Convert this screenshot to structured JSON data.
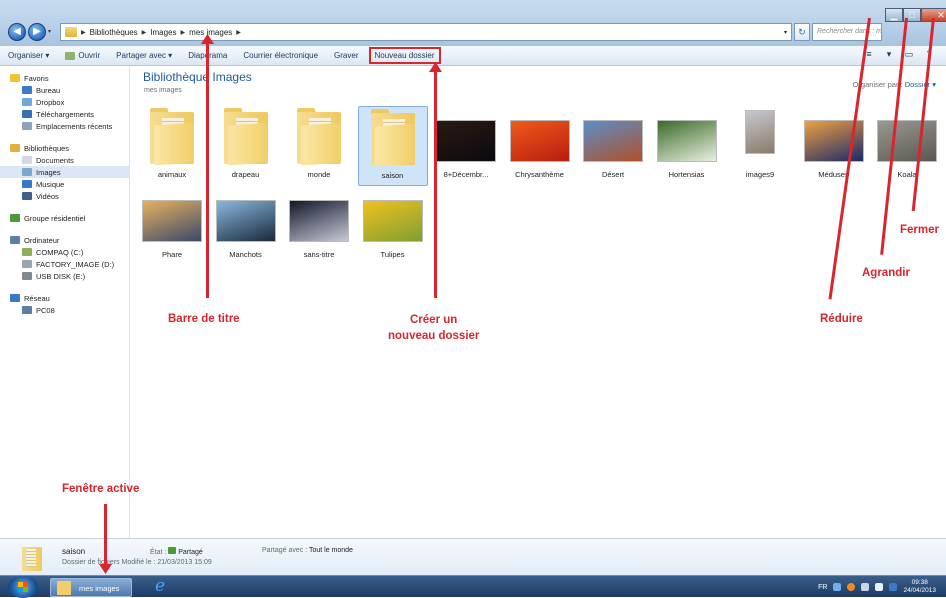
{
  "address": {
    "crumbs": [
      "Bibliothèques",
      "Images",
      "mes images"
    ]
  },
  "search": {
    "placeholder": "Rechercher dans : mes images"
  },
  "toolbar": {
    "items": [
      "Organiser ▾",
      "Ouvrir",
      "Partager avec ▾",
      "Diaporama",
      "Courrier électronique",
      "Graver",
      "Nouveau dossier"
    ]
  },
  "nav": {
    "items": [
      {
        "label": "Favoris",
        "icon": "star-icon",
        "color": "#f2c230",
        "indent": false,
        "gap": false
      },
      {
        "label": "Bureau",
        "icon": "desktop-icon",
        "color": "#3a78c8",
        "indent": true,
        "gap": false
      },
      {
        "label": "Dropbox",
        "icon": "dropbox-icon",
        "color": "#6fa8dc",
        "indent": true,
        "gap": false
      },
      {
        "label": "Téléchargements",
        "icon": "downloads-icon",
        "color": "#3a6fb5",
        "indent": true,
        "gap": false
      },
      {
        "label": "Emplacements récents",
        "icon": "recent-places-icon",
        "color": "#8da2bb",
        "indent": true,
        "gap": false
      },
      {
        "label": "Bibliothèques",
        "icon": "libraries-icon",
        "color": "#e2b13c",
        "indent": false,
        "gap": true
      },
      {
        "label": "Documents",
        "icon": "documents-icon",
        "color": "#cfd8e3",
        "indent": true,
        "gap": false
      },
      {
        "label": "Images",
        "icon": "pictures-icon",
        "color": "#7da7cf",
        "indent": true,
        "gap": false,
        "selected": true
      },
      {
        "label": "Musique",
        "icon": "music-icon",
        "color": "#3a78c8",
        "indent": true,
        "gap": false
      },
      {
        "label": "Vidéos",
        "icon": "videos-icon",
        "color": "#3f5f8c",
        "indent": true,
        "gap": false
      },
      {
        "label": "Groupe résidentiel",
        "icon": "homegroup-icon",
        "color": "#4a9a3a",
        "indent": false,
        "gap": true
      },
      {
        "label": "Ordinateur",
        "icon": "computer-icon",
        "color": "#5b7ea8",
        "indent": false,
        "gap": true
      },
      {
        "label": "COMPAQ (C:)",
        "icon": "drive-c-icon",
        "color": "#8fae5c",
        "indent": true,
        "gap": false
      },
      {
        "label": "FACTORY_IMAGE (D:)",
        "icon": "drive-d-icon",
        "color": "#9aa4ae",
        "indent": true,
        "gap": false
      },
      {
        "label": "USB DISK (E:)",
        "icon": "usb-drive-icon",
        "color": "#7f8891",
        "indent": true,
        "gap": false
      },
      {
        "label": "Réseau",
        "icon": "network-icon",
        "color": "#3a78c8",
        "indent": false,
        "gap": true
      },
      {
        "label": "PC08",
        "icon": "pc-icon",
        "color": "#5b7ea8",
        "indent": true,
        "gap": false
      }
    ]
  },
  "library": {
    "title": "Bibliothèque Images",
    "subtitle": "mes images",
    "arrange_label": "Organiser par :",
    "arrange_value": "Dossier ▾"
  },
  "files": [
    {
      "name": "animaux",
      "kind": "folder"
    },
    {
      "name": "drapeau",
      "kind": "folder"
    },
    {
      "name": "monde",
      "kind": "folder"
    },
    {
      "name": "saison",
      "kind": "folder",
      "selected": true
    },
    {
      "name": "8+Décembr...",
      "kind": "image",
      "c1": "#2a1a12",
      "c2": "#0b0a10"
    },
    {
      "name": "Chrysanthème",
      "kind": "image",
      "c1": "#f05a1a",
      "c2": "#b81d10"
    },
    {
      "name": "Désert",
      "kind": "image",
      "c1": "#5a8fc8",
      "c2": "#b0502a"
    },
    {
      "name": "Hortensias",
      "kind": "image",
      "c1": "#3b6a2a",
      "c2": "#e8f0e0"
    },
    {
      "name": "images9",
      "kind": "image",
      "c1": "#c8c8d0",
      "c2": "#8a7a6a",
      "tall": true
    },
    {
      "name": "Méduses",
      "kind": "image",
      "c1": "#f0a040",
      "c2": "#1a2a6a"
    },
    {
      "name": "Koala",
      "kind": "image",
      "c1": "#9a9890",
      "c2": "#5a5850"
    },
    {
      "name": "Phare",
      "kind": "image",
      "c1": "#e8b060",
      "c2": "#3a4a6a"
    },
    {
      "name": "Manchots",
      "kind": "image",
      "c1": "#8ab8e0",
      "c2": "#1a2a3a"
    },
    {
      "name": "sans-titre",
      "kind": "image",
      "c1": "#101828",
      "c2": "#c8c8d8"
    },
    {
      "name": "Tulipes",
      "kind": "image",
      "c1": "#f0c020",
      "c2": "#80a030"
    }
  ],
  "details": {
    "name": "saison",
    "type": "Dossier de fichiers  Modifié le : 21/03/2013 15:09",
    "state_label": "État :",
    "state_value": "Partagé",
    "share_label": "Partagé avec :",
    "share_value": "Tout le monde"
  },
  "taskbar": {
    "item": "mes images",
    "lang": "FR",
    "time": "09:38",
    "date": "24/04/2013"
  },
  "annotations": {
    "title_bar": "Barre de titre",
    "new_folder_1": "Créer un",
    "new_folder_2": "nouveau dossier",
    "minimize": "Réduire",
    "maximize": "Agrandir",
    "close": "Fermer",
    "active_window": "Fenêtre active"
  },
  "colors": {
    "annotation": "#d7262e",
    "accent": "#1e5a9a"
  }
}
